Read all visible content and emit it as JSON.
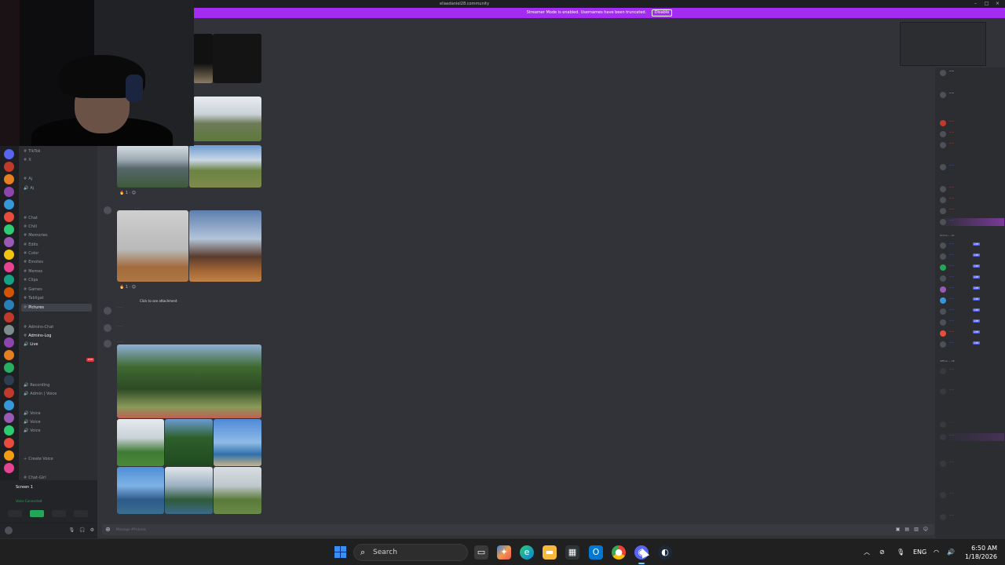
{
  "window": {
    "title": "eliasdaniel28.community",
    "controls": [
      "minimize-icon",
      "maximize-icon",
      "close-icon"
    ]
  },
  "banner": {
    "message": "Streamer Mode is enabled. Usernames have been truncated.",
    "disable_label": "Disable",
    "color": "#a32bf2"
  },
  "sidebar": {
    "items": [
      {
        "label": "TikTok",
        "kind": "channel"
      },
      {
        "label": "X",
        "kind": "channel"
      },
      {
        "label": "Aj",
        "kind": "channel"
      },
      {
        "label": "Aj",
        "kind": "channel"
      },
      {
        "label": "Chat",
        "kind": "channel"
      },
      {
        "label": "Chill",
        "kind": "channel"
      },
      {
        "label": "Memories",
        "kind": "channel"
      },
      {
        "label": "Edits",
        "kind": "channel"
      },
      {
        "label": "Color",
        "kind": "channel"
      },
      {
        "label": "Emotes",
        "kind": "channel"
      },
      {
        "label": "Memes",
        "kind": "channel"
      },
      {
        "label": "Clips",
        "kind": "channel"
      },
      {
        "label": "Games",
        "kind": "channel"
      },
      {
        "label": "Tabligat",
        "kind": "channel"
      },
      {
        "label": "Pictures",
        "kind": "channel",
        "active": true
      },
      {
        "label": "Admins-Chat",
        "kind": "channel"
      },
      {
        "label": "Admins-Log",
        "kind": "channel"
      },
      {
        "label": "Live",
        "kind": "voice"
      },
      {
        "label": "Recording",
        "kind": "voice"
      },
      {
        "label": "Admin | Voice",
        "kind": "voice"
      },
      {
        "label": "Voice",
        "kind": "voice"
      },
      {
        "label": "Voice",
        "kind": "voice"
      },
      {
        "label": "Voice",
        "kind": "voice"
      },
      {
        "label": "Create Voice",
        "kind": "voice"
      },
      {
        "label": "Chat-Girl",
        "kind": "channel"
      }
    ],
    "live_badge": "LIVE"
  },
  "voice_panel": {
    "screen_label": "Screen 1",
    "status": "Voice Connected"
  },
  "chat": {
    "attachment_hint": "Click to see attachment",
    "composer_placeholder": "Message #Pictures"
  },
  "members": {
    "categories": [
      "Online — 10",
      "Offline — 28"
    ],
    "app_badge": "APP"
  },
  "taskbar": {
    "search_placeholder": "Search",
    "language": "ENG",
    "time": "6:50 AM",
    "date": "1/18/2026",
    "apps": [
      "task-view-icon",
      "copilot-icon",
      "edge-icon",
      "file-explorer-icon",
      "store-icon",
      "outlook-icon",
      "chrome-icon",
      "discord-icon",
      "steam-icon"
    ]
  }
}
